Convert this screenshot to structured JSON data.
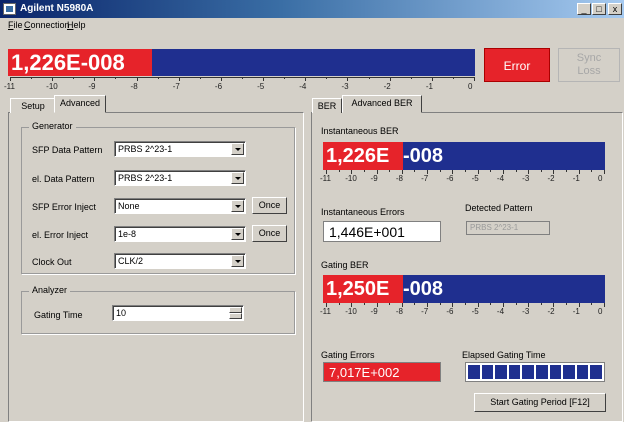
{
  "window": {
    "title": "Agilent N5980A",
    "min": "_",
    "max": "□",
    "close": "x"
  },
  "menu": {
    "file": "File",
    "file_key": "F",
    "connection": "Connection",
    "connection_key": "C",
    "help": "Help",
    "help_key": "H"
  },
  "top": {
    "ber_value": "1,226E-008",
    "scale": [
      "-11",
      "-10",
      "-9",
      "-8",
      "-7",
      "-6",
      "-5",
      "-4",
      "-3",
      "-2",
      "-1",
      "0"
    ],
    "error_label": "Error",
    "sync_label": "Sync Loss",
    "sync_line1": "Sync",
    "sync_line2": "Loss"
  },
  "left": {
    "tabs": [
      "Setup",
      "Advanced"
    ],
    "generator": {
      "title": "Generator",
      "rows": [
        {
          "label": "SFP Data Pattern",
          "value": "PRBS 2^23-1"
        },
        {
          "label": "el. Data Pattern",
          "value": "PRBS 2^23-1"
        },
        {
          "label": "SFP Error Inject",
          "value": "None",
          "button": "Once"
        },
        {
          "label": "el. Error Inject",
          "value": "1e-8",
          "button": "Once"
        },
        {
          "label": "Clock Out",
          "value": "CLK/2"
        }
      ]
    },
    "analyzer": {
      "title": "Analyzer",
      "gating_label": "Gating Time",
      "gating_value": "10"
    }
  },
  "right": {
    "tabs": [
      "BER",
      "Advanced BER"
    ],
    "inst_ber_label": "Instantaneous BER",
    "inst_ber_mantissa": "1,226E",
    "inst_ber_exp": "-008",
    "scale": [
      "-11",
      "-10",
      "-9",
      "-8",
      "-7",
      "-6",
      "-5",
      "-4",
      "-3",
      "-2",
      "-1",
      "0"
    ],
    "inst_errors_label": "Instantaneous Errors",
    "inst_errors_value": "1,446E+001",
    "detected_pattern_label": "Detected Pattern",
    "detected_pattern_value": "PRBS 2^23-1",
    "gating_ber_label": "Gating BER",
    "gating_ber_mantissa": "1,250E",
    "gating_ber_exp": "-008",
    "gating_errors_label": "Gating Errors",
    "gating_errors_value": "7,017E+002",
    "elapsed_label": "Elapsed Gating Time",
    "elapsed_fraction": 1.0,
    "start_button": "Start Gating Period  [F12]"
  }
}
